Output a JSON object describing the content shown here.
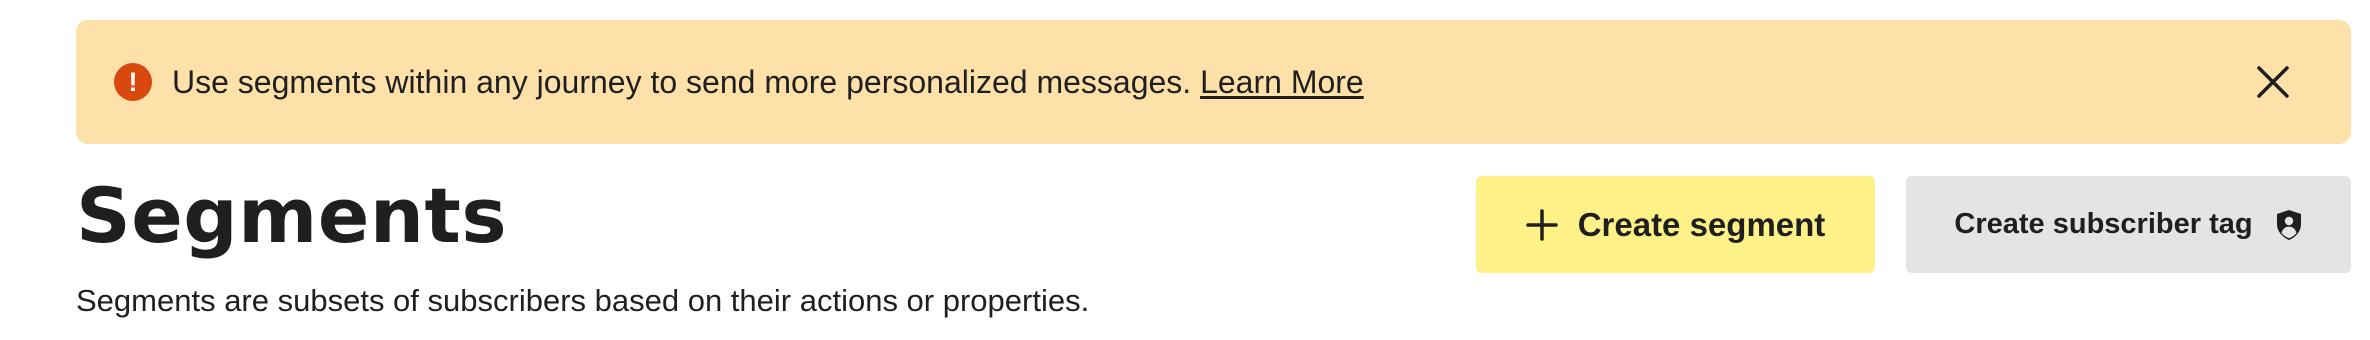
{
  "banner": {
    "message": "Use segments within any journey to send more personalized messages.",
    "link_label": "Learn More",
    "icon": "exclamation-circle-icon",
    "close_icon": "close-icon",
    "background_color": "#fde1a9",
    "icon_color": "#d9480f"
  },
  "header": {
    "title": "Segments",
    "subtitle": "Segments are subsets of subscribers based on their actions or properties."
  },
  "actions": {
    "create_segment_label": "Create segment",
    "create_segment_icon": "plus-icon",
    "create_segment_color": "#fdf187",
    "create_tag_label": "Create subscriber tag",
    "create_tag_icon": "shield-user-icon",
    "create_tag_color": "#e3e4e4"
  }
}
